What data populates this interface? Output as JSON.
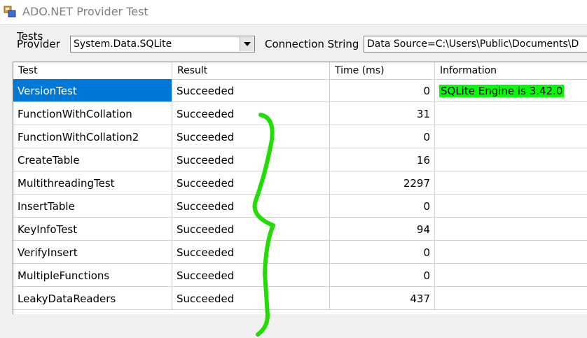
{
  "window": {
    "title": "ADO.NET Provider Test"
  },
  "menu": {
    "tests": "Tests"
  },
  "provider": {
    "label": "Provider",
    "value": "System.Data.SQLite"
  },
  "connection": {
    "label": "Connection String",
    "value": "Data Source=C:\\Users\\Public\\Documents\\D"
  },
  "grid": {
    "columns": [
      "Test",
      "Result",
      "Time (ms)",
      "Information"
    ],
    "rows": [
      {
        "test": "VersionTest",
        "result": "Succeeded",
        "time": "0",
        "info": "SQLite Engine is 3.42.0"
      },
      {
        "test": "FunctionWithCollation",
        "result": "Succeeded",
        "time": "31",
        "info": ""
      },
      {
        "test": "FunctionWithCollation2",
        "result": "Succeeded",
        "time": "0",
        "info": ""
      },
      {
        "test": "CreateTable",
        "result": "Succeeded",
        "time": "16",
        "info": ""
      },
      {
        "test": "MultithreadingTest",
        "result": "Succeeded",
        "time": "2297",
        "info": ""
      },
      {
        "test": "InsertTable",
        "result": "Succeeded",
        "time": "0",
        "info": ""
      },
      {
        "test": "KeyInfoTest",
        "result": "Succeeded",
        "time": "94",
        "info": ""
      },
      {
        "test": "VerifyInsert",
        "result": "Succeeded",
        "time": "0",
        "info": ""
      },
      {
        "test": "MultipleFunctions",
        "result": "Succeeded",
        "time": "0",
        "info": ""
      },
      {
        "test": "LeakyDataReaders",
        "result": "Succeeded",
        "time": "437",
        "info": ""
      }
    ]
  },
  "colors": {
    "selection": "#0078d7",
    "highlight": "#00ff00",
    "annotation": "#22dd00"
  },
  "icons": {
    "app": "app-icon",
    "dropdown": "chevron-down-icon"
  }
}
